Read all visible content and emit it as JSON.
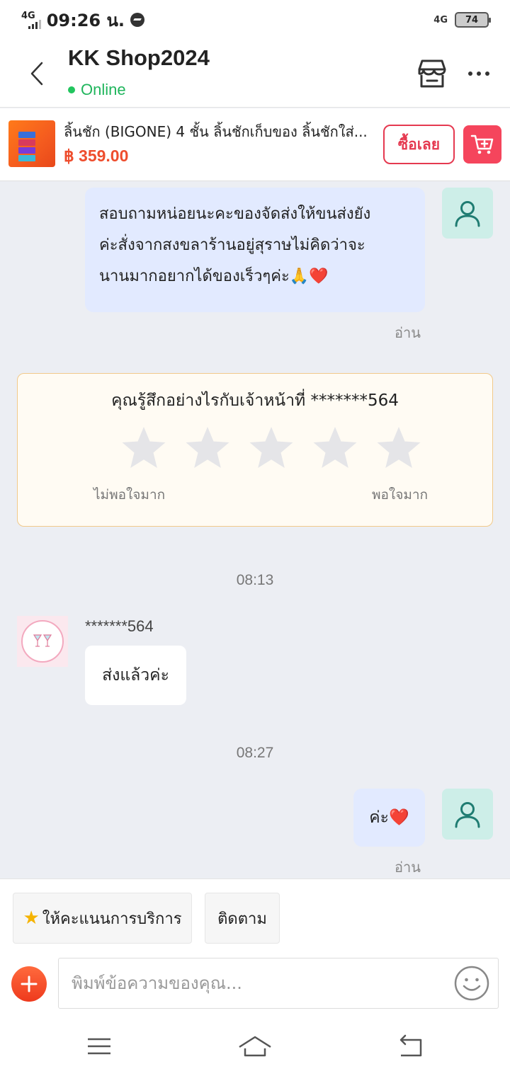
{
  "status_bar": {
    "network_left": "4G",
    "time": "09:26 น.",
    "network_right": "4G",
    "battery": "74"
  },
  "header": {
    "shop_name": "KK Shop2024",
    "status": "Online"
  },
  "product": {
    "title": "ลิ้นชัก (BIGONE)  4 ชั้น ลิ้นชักเก็บของ ลิ้นชักใส่...",
    "price": "฿ 359.00",
    "buy_label": "ซื้อเลย"
  },
  "messages": {
    "first_outgoing": {
      "lines": [
        "สอบถามหน่อยนะคะของจัดส่งให้ขนส่งยัง",
        "ค่ะสั่งจากสงขลาร้านอยู่สุราษไม่คิดว่าจะ",
        "นานมากอยากได้ของเร็วๆค่ะ🙏❤️"
      ],
      "read": "อ่าน"
    },
    "rating": {
      "question": "คุณรู้สึกอย่างไรกับเจ้าหน้าที่ *******564",
      "low_label": "ไม่พอใจมาก",
      "high_label": "พอใจมาก",
      "stars": 0,
      "max_stars": 5
    },
    "time_1": "08:13",
    "incoming": {
      "sender": "*******564",
      "text": "ส่งแล้วค่ะ"
    },
    "time_2": "08:27",
    "second_outgoing": {
      "text": "ค่ะ❤️",
      "read": "อ่าน"
    }
  },
  "bottom": {
    "chip_rate": "ให้คะแนนการบริการ",
    "chip_follow": "ติดตาม",
    "input_placeholder": "พิมพ์ข้อความของคุณ..."
  },
  "colors": {
    "accent": "#ee4d2d",
    "online": "#22c55e",
    "bubble_out": "#e2eaff",
    "buy_border": "#e53950"
  }
}
